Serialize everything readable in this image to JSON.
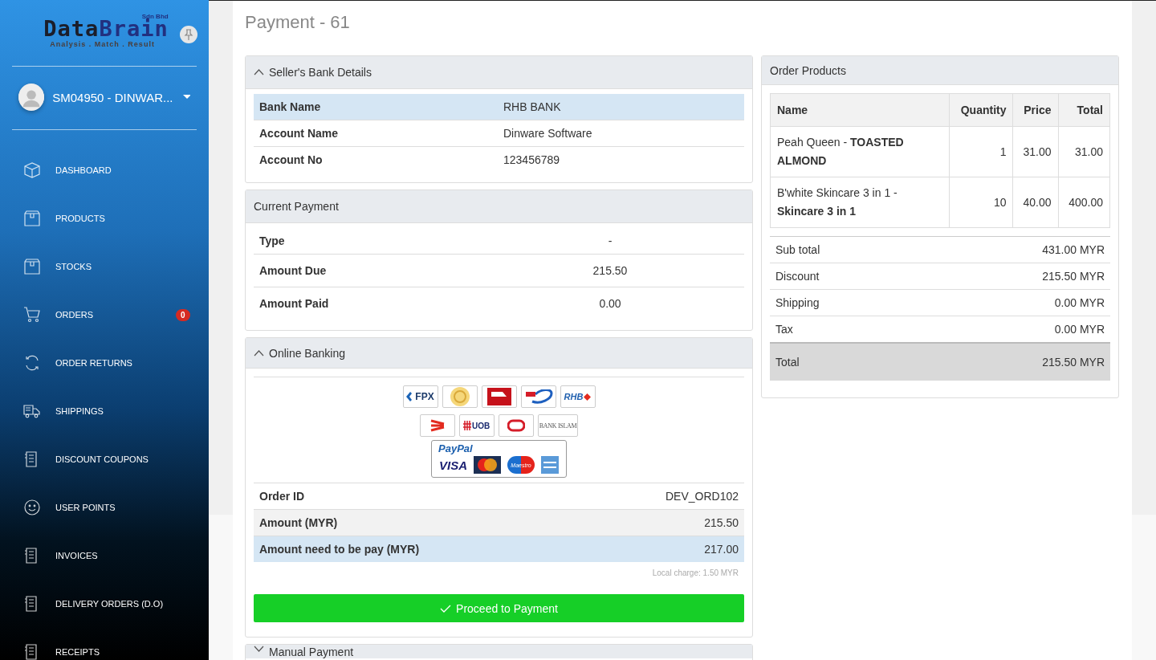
{
  "sidebar": {
    "logo": {
      "name_dark": "Data",
      "name_blue": "Brain",
      "suffix": "Sdn Bhd",
      "tagline": "Analysis . Match . Result"
    },
    "user": {
      "name": "SM04950 - DINWAR..."
    },
    "items": [
      {
        "label": "DASHBOARD"
      },
      {
        "label": "PRODUCTS"
      },
      {
        "label": "STOCKS"
      },
      {
        "label": "ORDERS",
        "badge": "0"
      },
      {
        "label": "ORDER RETURNS"
      },
      {
        "label": "SHIPPINGS"
      },
      {
        "label": "DISCOUNT COUPONS"
      },
      {
        "label": "USER POINTS"
      },
      {
        "label": "INVOICES"
      },
      {
        "label": "DELIVERY ORDERS (D.O)"
      },
      {
        "label": "RECEIPTS"
      }
    ]
  },
  "page_title": "Payment - 61",
  "seller_bank": {
    "title": "Seller's Bank Details",
    "expanded": true,
    "rows": [
      {
        "label": "Bank Name",
        "value": "RHB BANK",
        "highlighted": true
      },
      {
        "label": "Account Name",
        "value": "Dinware Software",
        "highlighted": false
      },
      {
        "label": "Account No",
        "value": "123456789",
        "highlighted": false
      }
    ]
  },
  "current_payment": {
    "title": "Current Payment",
    "rows": [
      {
        "label": "Type",
        "value": "-"
      },
      {
        "label": "Amount Due",
        "value": "215.50"
      },
      {
        "label": "Amount Paid",
        "value": "0.00"
      }
    ]
  },
  "online_banking": {
    "title": "Online Banking",
    "expanded": true,
    "banks": [
      {
        "kind": "fpx",
        "text": "FPX"
      },
      {
        "kind": "crest"
      },
      {
        "kind": "flag"
      },
      {
        "kind": "pb"
      },
      {
        "kind": "rhb",
        "text": "RHB"
      },
      {
        "kind": "stripes"
      },
      {
        "kind": "uob",
        "text": "UOB"
      },
      {
        "kind": "ring"
      },
      {
        "kind": "islam",
        "text": "BANK ISLAM"
      }
    ],
    "paypal": {
      "title": "PayPal",
      "cards": [
        {
          "kind": "visa",
          "text": "VISA"
        },
        {
          "kind": "mastercard"
        },
        {
          "kind": "maestro",
          "text": "Maestro"
        },
        {
          "kind": "amex"
        }
      ]
    },
    "rows": [
      {
        "label": "Order ID",
        "value": "DEV_ORD102",
        "striped": false,
        "highlighted": false
      },
      {
        "label": "Amount (MYR)",
        "value": "215.50",
        "striped": true,
        "highlighted": false
      },
      {
        "label": "Amount need to be pay (MYR)",
        "value": "217.00",
        "highlighted": true
      }
    ],
    "note": "Local charge: 1.50 MYR",
    "button": "Proceed to Payment"
  },
  "manual_payment": {
    "title": "Manual Payment",
    "expanded": false
  },
  "order_products": {
    "title": "Order Products",
    "columns": [
      "Name",
      "Quantity",
      "Price",
      "Total"
    ],
    "rows": [
      [
        "Peah Queen - **TOASTED ALMOND**",
        "1",
        "31.00",
        "31.00"
      ],
      [
        "B'white Skincare 3 in 1 - **Skincare 3 in 1**",
        "10",
        "40.00",
        "400.00"
      ]
    ],
    "summary": [
      {
        "label": "Sub total",
        "value": "431.00 MYR",
        "total": false
      },
      {
        "label": "Discount",
        "value": "215.50 MYR",
        "total": false
      },
      {
        "label": "Shipping",
        "value": "0.00 MYR",
        "total": false
      },
      {
        "label": "Tax",
        "value": "0.00 MYR",
        "total": false
      },
      {
        "label": "Total",
        "value": "215.50 MYR",
        "total": true
      }
    ]
  }
}
